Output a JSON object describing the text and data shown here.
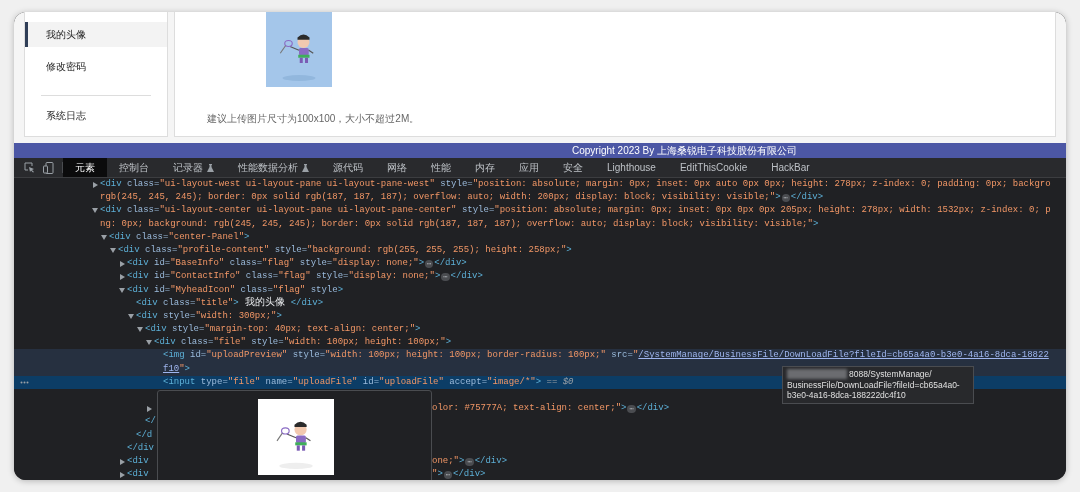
{
  "sidebar": {
    "items": [
      {
        "label": "我的头像",
        "selected": true
      },
      {
        "label": "修改密码",
        "selected": false
      },
      {
        "label": "系统日志",
        "selected": false
      }
    ]
  },
  "hint": "建议上传图片尺寸为100x100，大小不超过2M。",
  "footer": {
    "copyright": "Copyright 2023 By 上海桑锐电子科技股份有限公司"
  },
  "devtools": {
    "tabs": [
      {
        "label": "元素",
        "selected": true,
        "experimental": false
      },
      {
        "label": "控制台",
        "selected": false,
        "experimental": false
      },
      {
        "label": "记录器",
        "selected": false,
        "experimental": true
      },
      {
        "label": "性能数据分析",
        "selected": false,
        "experimental": true
      },
      {
        "label": "源代码",
        "selected": false,
        "experimental": false
      },
      {
        "label": "网络",
        "selected": false,
        "experimental": false
      },
      {
        "label": "性能",
        "selected": false,
        "experimental": false
      },
      {
        "label": "内存",
        "selected": false,
        "experimental": false
      },
      {
        "label": "应用",
        "selected": false,
        "experimental": false
      },
      {
        "label": "安全",
        "selected": false,
        "experimental": false
      },
      {
        "label": "Lighthouse",
        "selected": false,
        "experimental": false
      },
      {
        "label": "EditThisCookie",
        "selected": false,
        "experimental": false
      },
      {
        "label": "HackBar",
        "selected": false,
        "experimental": false
      }
    ],
    "tree": [
      {
        "kind": "collapsed",
        "selected": false,
        "hovered": false,
        "lines": [
          {
            "segments": [
              {
                "kind": "tag",
                "text": "<div"
              },
              {
                "kind": "attr",
                "text": " class="
              },
              {
                "kind": "value",
                "text": "\"ui-layout-west ui-layout-pane ui-layout-pane-west\""
              },
              {
                "kind": "attr",
                "text": " style="
              },
              {
                "kind": "value",
                "text": "\"position: absolute; margin: 0px; inset: 0px auto 0px 0px; height: 278px; z-index: 0; padding: 0px; backgro"
              }
            ]
          },
          {
            "segments": [
              {
                "kind": "value",
                "text": "rgb(245, 245, 245); border: 0px solid rgb(187, 187, 187); overflow: auto; width: 200px; display: block; visibility: visible;\""
              },
              {
                "kind": "tag",
                "text": ">"
              },
              {
                "kind": "ellipsis",
                "text": "⋯"
              },
              {
                "kind": "tag",
                "text": "</div>"
              }
            ]
          }
        ]
      },
      {
        "kind": "expanded",
        "selected": false,
        "hovered": false,
        "lines": [
          {
            "segments": [
              {
                "kind": "tag",
                "text": "<div"
              },
              {
                "kind": "attr",
                "text": " class="
              },
              {
                "kind": "value",
                "text": "\"ui-layout-center ui-layout-pane ui-layout-pane-center\""
              },
              {
                "kind": "attr",
                "text": " style="
              },
              {
                "kind": "value",
                "text": "\"position: absolute; margin: 0px; inset: 0px 0px 0px 205px; height: 278px; width: 1532px; z-index: 0; p"
              }
            ]
          },
          {
            "segments": [
              {
                "kind": "value",
                "text": "ng: 0px; background: rgb(245, 245, 245); border: 0px solid rgb(187, 187, 187); overflow: auto; display: block; visibility: visible;\""
              },
              {
                "kind": "tag",
                "text": ">"
              }
            ]
          }
        ],
        "children": [
          {
            "kind": "expanded",
            "selected": false,
            "hovered": false,
            "lines": [
              {
                "segments": [
                  {
                    "kind": "tag",
                    "text": "<div"
                  },
                  {
                    "kind": "attr",
                    "text": " class="
                  },
                  {
                    "kind": "value",
                    "text": "\"center-Panel\""
                  },
                  {
                    "kind": "tag",
                    "text": ">"
                  }
                ]
              }
            ],
            "children": [
              {
                "kind": "expanded",
                "selected": false,
                "hovered": false,
                "lines": [
                  {
                    "segments": [
                      {
                        "kind": "tag",
                        "text": "<div"
                      },
                      {
                        "kind": "attr",
                        "text": " class="
                      },
                      {
                        "kind": "value",
                        "text": "\"profile-content\""
                      },
                      {
                        "kind": "attr",
                        "text": " style="
                      },
                      {
                        "kind": "value",
                        "text": "\"background: rgb(255, 255, 255); height: 258px;\""
                      },
                      {
                        "kind": "tag",
                        "text": ">"
                      }
                    ]
                  }
                ],
                "children": [
                  {
                    "kind": "collapsed",
                    "selected": false,
                    "hovered": false,
                    "lines": [
                      {
                        "segments": [
                          {
                            "kind": "tag",
                            "text": "<div"
                          },
                          {
                            "kind": "attr",
                            "text": " id="
                          },
                          {
                            "kind": "value",
                            "text": "\"BaseInfo\""
                          },
                          {
                            "kind": "attr",
                            "text": " class="
                          },
                          {
                            "kind": "value",
                            "text": "\"flag\""
                          },
                          {
                            "kind": "attr",
                            "text": " style="
                          },
                          {
                            "kind": "value",
                            "text": "\"display: none;\""
                          },
                          {
                            "kind": "tag",
                            "text": ">"
                          },
                          {
                            "kind": "ellipsis",
                            "text": "⋯"
                          },
                          {
                            "kind": "tag",
                            "text": "</div>"
                          }
                        ]
                      }
                    ]
                  },
                  {
                    "kind": "collapsed",
                    "selected": false,
                    "hovered": false,
                    "lines": [
                      {
                        "segments": [
                          {
                            "kind": "tag",
                            "text": "<div"
                          },
                          {
                            "kind": "attr",
                            "text": " id="
                          },
                          {
                            "kind": "value",
                            "text": "\"ContactInfo\""
                          },
                          {
                            "kind": "attr",
                            "text": " class="
                          },
                          {
                            "kind": "value",
                            "text": "\"flag\""
                          },
                          {
                            "kind": "attr",
                            "text": " style="
                          },
                          {
                            "kind": "value",
                            "text": "\"display: none;\""
                          },
                          {
                            "kind": "tag",
                            "text": ">"
                          },
                          {
                            "kind": "ellipsis",
                            "text": "⋯"
                          },
                          {
                            "kind": "tag",
                            "text": "</div>"
                          }
                        ]
                      }
                    ]
                  },
                  {
                    "kind": "expanded",
                    "selected": false,
                    "hovered": false,
                    "lines": [
                      {
                        "segments": [
                          {
                            "kind": "tag",
                            "text": "<div"
                          },
                          {
                            "kind": "attr",
                            "text": " id="
                          },
                          {
                            "kind": "value",
                            "text": "\"MyheadIcon\""
                          },
                          {
                            "kind": "attr",
                            "text": " class="
                          },
                          {
                            "kind": "value",
                            "text": "\"flag\""
                          },
                          {
                            "kind": "attr",
                            "text": " style"
                          },
                          {
                            "kind": "tag",
                            "text": ">"
                          }
                        ]
                      }
                    ],
                    "children": [
                      {
                        "kind": "leaf",
                        "selected": false,
                        "hovered": false,
                        "lines": [
                          {
                            "segments": [
                              {
                                "kind": "tag",
                                "text": "<div"
                              },
                              {
                                "kind": "attr",
                                "text": " class="
                              },
                              {
                                "kind": "value",
                                "text": "\"title\""
                              },
                              {
                                "kind": "tag",
                                "text": ">"
                              },
                              {
                                "kind": "text",
                                "text": " 我的头像 "
                              },
                              {
                                "kind": "tag",
                                "text": "</div>"
                              }
                            ]
                          }
                        ]
                      },
                      {
                        "kind": "expanded",
                        "selected": false,
                        "hovered": false,
                        "lines": [
                          {
                            "segments": [
                              {
                                "kind": "tag",
                                "text": "<div"
                              },
                              {
                                "kind": "attr",
                                "text": " style="
                              },
                              {
                                "kind": "value",
                                "text": "\"width: 300px;\""
                              },
                              {
                                "kind": "tag",
                                "text": ">"
                              }
                            ]
                          }
                        ],
                        "children": [
                          {
                            "kind": "expanded",
                            "selected": false,
                            "hovered": false,
                            "lines": [
                              {
                                "segments": [
                                  {
                                    "kind": "tag",
                                    "text": "<div"
                                  },
                                  {
                                    "kind": "attr",
                                    "text": " style="
                                  },
                                  {
                                    "kind": "value",
                                    "text": "\"margin-top: 40px; text-align: center;\""
                                  },
                                  {
                                    "kind": "tag",
                                    "text": ">"
                                  }
                                ]
                              }
                            ],
                            "children": [
                              {
                                "kind": "expanded",
                                "selected": false,
                                "hovered": false,
                                "lines": [
                                  {
                                    "segments": [
                                      {
                                        "kind": "tag",
                                        "text": "<div"
                                      },
                                      {
                                        "kind": "attr",
                                        "text": " class="
                                      },
                                      {
                                        "kind": "value",
                                        "text": "\"file\""
                                      },
                                      {
                                        "kind": "attr",
                                        "text": " style="
                                      },
                                      {
                                        "kind": "value",
                                        "text": "\"width: 100px; height: 100px;\""
                                      },
                                      {
                                        "kind": "tag",
                                        "text": ">"
                                      }
                                    ]
                                  }
                                ],
                                "children": [
                                  {
                                    "kind": "leaf",
                                    "selected": false,
                                    "hovered": true,
                                    "lines": [
                                      {
                                        "segments": [
                                          {
                                            "kind": "tag",
                                            "text": "<img"
                                          },
                                          {
                                            "kind": "attr",
                                            "text": " id="
                                          },
                                          {
                                            "kind": "value",
                                            "text": "\"uploadPreview\""
                                          },
                                          {
                                            "kind": "attr",
                                            "text": " style="
                                          },
                                          {
                                            "kind": "value",
                                            "text": "\"width: 100px; height: 100px; border-radius: 100px;\""
                                          },
                                          {
                                            "kind": "attr",
                                            "text": " src="
                                          },
                                          {
                                            "kind": "value",
                                            "text": "\""
                                          },
                                          {
                                            "kind": "link",
                                            "text": "/SystemManage/BusinessFile/DownLoadFile?fileId=cb65a4a0-b3e0-4a16-8dca-18822"
                                          }
                                        ]
                                      },
                                      {
                                        "segments": [
                                          {
                                            "kind": "link",
                                            "text": "f10"
                                          },
                                          {
                                            "kind": "value",
                                            "text": "\""
                                          },
                                          {
                                            "kind": "tag",
                                            "text": ">"
                                          }
                                        ]
                                      }
                                    ]
                                  },
                                  {
                                    "kind": "leaf",
                                    "selected": true,
                                    "hovered": false,
                                    "lines": [
                                      {
                                        "segments": [
                                          {
                                            "kind": "tag",
                                            "text": "<input"
                                          },
                                          {
                                            "kind": "attr",
                                            "text": " type="
                                          },
                                          {
                                            "kind": "value",
                                            "text": "\"file\""
                                          },
                                          {
                                            "kind": "attr",
                                            "text": " name="
                                          },
                                          {
                                            "kind": "value",
                                            "text": "\"uploadFile\""
                                          },
                                          {
                                            "kind": "attr",
                                            "text": " id="
                                          },
                                          {
                                            "kind": "value",
                                            "text": "\"uploadFile\""
                                          },
                                          {
                                            "kind": "attr",
                                            "text": " accept="
                                          },
                                          {
                                            "kind": "value",
                                            "text": "\"image/*\""
                                          },
                                          {
                                            "kind": "tag",
                                            "text": ">"
                                          },
                                          {
                                            "kind": "console",
                                            "text": " == $0"
                                          }
                                        ]
                                      }
                                    ]
                                  }
                                ],
                                "close": {
                                  "covered": true
                                }
                              },
                              {
                                "kind": "collapsed",
                                "selected": false,
                                "hovered": false,
                                "lines": [
                                  {
                                    "covered": true,
                                    "after_popup": [
                                      {
                                        "kind": "value",
                                        "text": "olor: #75777A; text-align: center;\""
                                      },
                                      {
                                        "kind": "tag",
                                        "text": ">"
                                      },
                                      {
                                        "kind": "ellipsis",
                                        "text": "⋯"
                                      },
                                      {
                                        "kind": "tag",
                                        "text": "</div>"
                                      }
                                    ]
                                  }
                                ]
                              }
                            ],
                            "close": {
                              "segments": [
                                {
                                  "kind": "tag",
                                  "text": "</"
                                }
                              ]
                            }
                          }
                        ],
                        "close": {
                          "segments": [
                            {
                              "kind": "tag",
                              "text": "</d"
                            }
                          ]
                        }
                      }
                    ],
                    "close": {
                      "segments": [
                        {
                          "kind": "tag",
                          "text": "</div"
                        }
                      ]
                    }
                  },
                  {
                    "kind": "collapsed",
                    "selected": false,
                    "hovered": false,
                    "lines": [
                      {
                        "segments": [
                          {
                            "kind": "tag",
                            "text": "<div"
                          }
                        ],
                        "after_popup": [
                          {
                            "kind": "value",
                            "text": "one;\""
                          },
                          {
                            "kind": "tag",
                            "text": ">"
                          },
                          {
                            "kind": "ellipsis",
                            "text": "⋯"
                          },
                          {
                            "kind": "tag",
                            "text": "</div>"
                          }
                        ]
                      }
                    ]
                  },
                  {
                    "kind": "collapsed",
                    "selected": false,
                    "hovered": false,
                    "lines": [
                      {
                        "segments": [
                          {
                            "kind": "tag",
                            "text": "<div"
                          }
                        ],
                        "after_popup": [
                          {
                            "kind": "value",
                            "text": "\""
                          },
                          {
                            "kind": "tag",
                            "text": ">"
                          },
                          {
                            "kind": "ellipsis",
                            "text": "⋯"
                          },
                          {
                            "kind": "tag",
                            "text": "</div>"
                          }
                        ]
                      }
                    ]
                  }
                ]
              }
            ]
          }
        ]
      }
    ],
    "tooltip": {
      "redacted": true,
      "lines": [
        "8088/SystemManage/",
        "BusinessFile/DownLoadFile?fileId=cb65a4a0-",
        "b3e0-4a16-8dca-188222dc4f10"
      ]
    }
  }
}
